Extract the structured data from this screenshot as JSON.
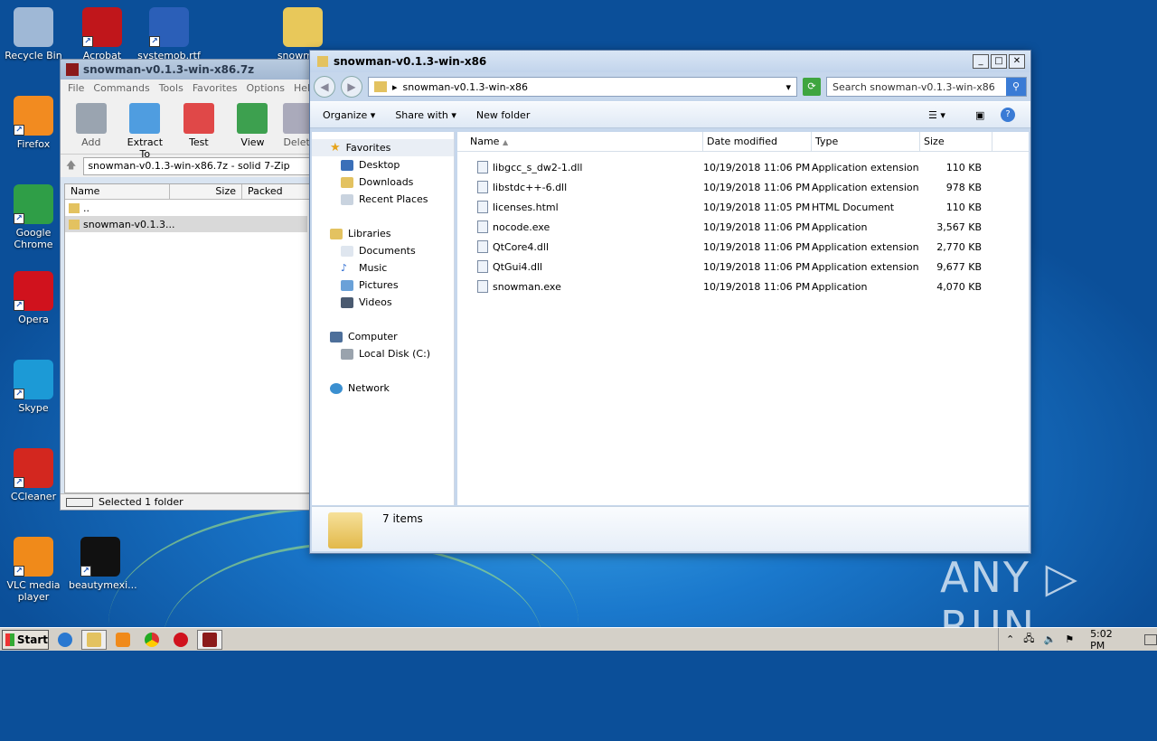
{
  "desktop": {
    "icons": [
      {
        "label": "Recycle Bin",
        "color": "#9fb8d6"
      },
      {
        "label": "Acrobat",
        "color": "#c0161b"
      },
      {
        "label": "systemob.rtf",
        "color": "#2b5fb8"
      },
      {
        "label": "snowma...",
        "color": "#e8c85a"
      },
      {
        "label": "Firefox",
        "color": "#f28b20"
      },
      {
        "label": "Google Chrome",
        "color": "#2f9e47"
      },
      {
        "label": "Opera",
        "color": "#d0121d"
      },
      {
        "label": "Skype",
        "color": "#1c9ad6"
      },
      {
        "label": "CCleaner",
        "color": "#d3271f"
      },
      {
        "label": "VLC media player",
        "color": "#f08a1a"
      },
      {
        "label": "beautymexi...",
        "color": "#111111"
      }
    ]
  },
  "sevenzip": {
    "title": "snowman-v0.1.3-win-x86.7z",
    "menu": [
      "File",
      "Commands",
      "Tools",
      "Favorites",
      "Options",
      "Help"
    ],
    "toolbar": [
      "Add",
      "Extract To",
      "Test",
      "View",
      "Delet"
    ],
    "path": "snowman-v0.1.3-win-x86.7z - solid 7-Zip",
    "columns": [
      "Name",
      "Size",
      "Packed"
    ],
    "rows": [
      "..",
      "snowman-v0.1.3..."
    ],
    "status": "Selected 1 folder"
  },
  "explorer": {
    "title": "snowman-v0.1.3-win-x86",
    "address": "snowman-v0.1.3-win-x86",
    "search_placeholder": "Search snowman-v0.1.3-win-x86",
    "commands": [
      "Organize",
      "Share with",
      "New folder"
    ],
    "nav": {
      "favorites": "Favorites",
      "fav_items": [
        "Desktop",
        "Downloads",
        "Recent Places"
      ],
      "libraries": "Libraries",
      "lib_items": [
        "Documents",
        "Music",
        "Pictures",
        "Videos"
      ],
      "computer": "Computer",
      "comp_items": [
        "Local Disk (C:)"
      ],
      "network": "Network"
    },
    "columns": [
      "Name",
      "Date modified",
      "Type",
      "Size"
    ],
    "files": [
      {
        "name": "libgcc_s_dw2-1.dll",
        "date": "10/19/2018 11:06 PM",
        "type": "Application extension",
        "size": "110 KB"
      },
      {
        "name": "libstdc++-6.dll",
        "date": "10/19/2018 11:06 PM",
        "type": "Application extension",
        "size": "978 KB"
      },
      {
        "name": "licenses.html",
        "date": "10/19/2018 11:05 PM",
        "type": "HTML Document",
        "size": "110 KB"
      },
      {
        "name": "nocode.exe",
        "date": "10/19/2018 11:06 PM",
        "type": "Application",
        "size": "3,567 KB"
      },
      {
        "name": "QtCore4.dll",
        "date": "10/19/2018 11:06 PM",
        "type": "Application extension",
        "size": "2,770 KB"
      },
      {
        "name": "QtGui4.dll",
        "date": "10/19/2018 11:06 PM",
        "type": "Application extension",
        "size": "9,677 KB"
      },
      {
        "name": "snowman.exe",
        "date": "10/19/2018 11:06 PM",
        "type": "Application",
        "size": "4,070 KB"
      }
    ],
    "item_count": "7 items"
  },
  "taskbar": {
    "start": "Start",
    "clock": "5:02 PM"
  },
  "watermark": "ANY ▷ RUN"
}
